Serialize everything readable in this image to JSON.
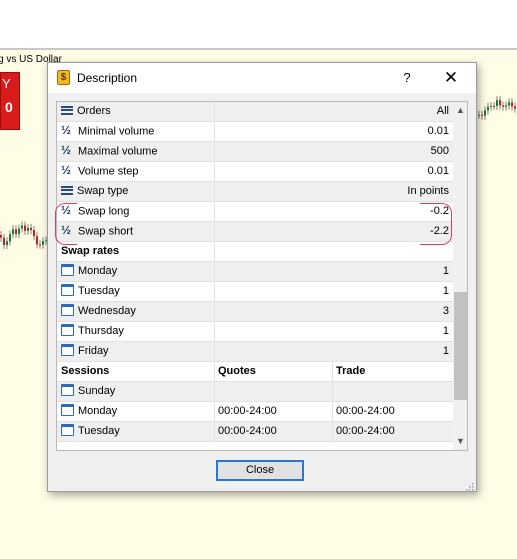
{
  "background": {
    "symbol_text": "g vs US Dollar",
    "trade_letter": "Y",
    "trade_digit": "0"
  },
  "dialog": {
    "title": "Description",
    "help_label": "?",
    "close_icon_glyph": "✕",
    "close_button_label": "Close"
  },
  "spec_rows": [
    {
      "icon": "list-icon",
      "name": "Orders",
      "value": "All"
    },
    {
      "icon": "fraction-icon",
      "name": "Minimal volume",
      "value": "0.01"
    },
    {
      "icon": "fraction-icon",
      "name": "Maximal volume",
      "value": "500"
    },
    {
      "icon": "fraction-icon",
      "name": "Volume step",
      "value": "0.01"
    },
    {
      "icon": "list-icon",
      "name": "Swap type",
      "value": "In points"
    },
    {
      "icon": "fraction-icon",
      "name": "Swap long",
      "value": "-0.2"
    },
    {
      "icon": "fraction-icon",
      "name": "Swap short",
      "value": "-2.2"
    }
  ],
  "swap_rates": {
    "header": "Swap rates",
    "rows": [
      {
        "name": "Monday",
        "value": "1"
      },
      {
        "name": "Tuesday",
        "value": "1"
      },
      {
        "name": "Wednesday",
        "value": "3"
      },
      {
        "name": "Thursday",
        "value": "1"
      },
      {
        "name": "Friday",
        "value": "1"
      }
    ]
  },
  "sessions": {
    "header": "Sessions",
    "col_quotes": "Quotes",
    "col_trade": "Trade",
    "rows": [
      {
        "name": "Sunday",
        "quotes": "",
        "trade": ""
      },
      {
        "name": "Monday",
        "quotes": "00:00-24:00",
        "trade": "00:00-24:00"
      },
      {
        "name": "Tuesday",
        "quotes": "00:00-24:00",
        "trade": "00:00-24:00"
      }
    ]
  },
  "colors": {
    "chart_bg": "#fffde6",
    "annotation": "#e63a5a",
    "focus_border": "#2a76d0"
  }
}
